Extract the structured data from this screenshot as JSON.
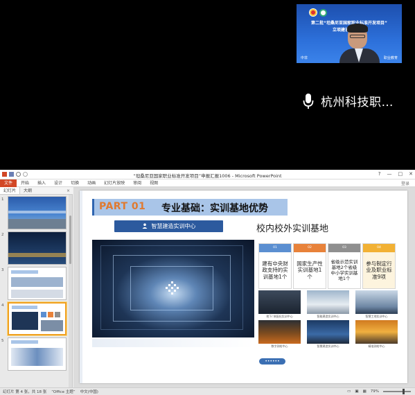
{
  "video": {
    "title_line1": "第二批“坦桑尼亚国家职业标准开发项目”",
    "title_line2": "立项建设论证会议",
    "sub_left": "中非",
    "sub_right": "职业教育"
  },
  "caller": {
    "name": "杭州科技职…",
    "icon": "microphone-icon"
  },
  "window": {
    "title": "“坦桑尼亚国家职业标准开发项目”申报汇报1006 - Microsoft PowerPoint",
    "controls": [
      "?",
      "—",
      "□",
      "✕"
    ]
  },
  "ribbon": {
    "tabs": [
      "文件",
      "开始",
      "插入",
      "设计",
      "切换",
      "动画",
      "幻灯片放映",
      "审阅",
      "视图"
    ],
    "right": "登录"
  },
  "panel": {
    "tabs": [
      "幻灯片",
      "大纲"
    ],
    "close": "×",
    "slides": [
      {
        "num": "1",
        "selected": false
      },
      {
        "num": "2",
        "selected": false
      },
      {
        "num": "3",
        "selected": false
      },
      {
        "num": "4",
        "selected": true
      },
      {
        "num": "5",
        "selected": false
      }
    ]
  },
  "slide": {
    "part_no": "PART 01",
    "part_title": "专业基础：实训基地优势",
    "center_badge": "智慧建造实训中心",
    "bases_heading": "校内校外实训基地",
    "cards": [
      {
        "head": "01",
        "body": "建有中央财政支持的实训基地1个",
        "color": "#5b8fd1"
      },
      {
        "head": "02",
        "body": "国家生产性实训基地1个",
        "color": "#e8823a"
      },
      {
        "head": "03",
        "body": "省级示范实训基地2个省级中小学实训基地1个",
        "color": "#8f8f8f"
      },
      {
        "head": "04",
        "body": "参与制定行业及职业标准9项",
        "color": "#f2b134"
      }
    ],
    "photos": [
      {
        "caption": "地下/ 装配化实训中心"
      },
      {
        "caption": "智能建造实训中心"
      },
      {
        "caption": "智慧工地实训中心"
      },
      {
        "caption": "数字测绘中心"
      },
      {
        "caption": "智慧建造实训中心"
      },
      {
        "caption": "精准测绘中心"
      }
    ],
    "more_button": "••••••"
  },
  "status": {
    "slide_info": "幻灯片 第 4 张，共 18 张",
    "theme": "“Office 主题”",
    "language": "中文(中国)",
    "zoom": "79%",
    "zoom_fraction": 0.7
  }
}
